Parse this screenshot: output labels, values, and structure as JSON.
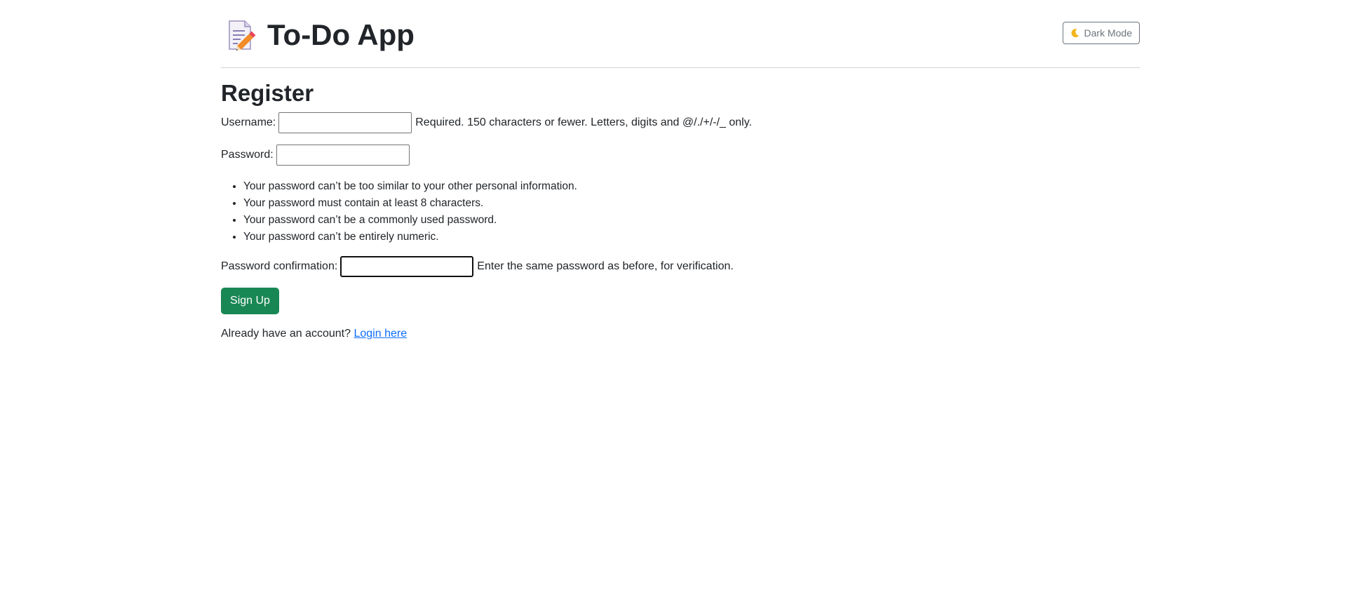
{
  "header": {
    "app_title": "To-Do App",
    "app_icon": "memo-pencil-icon",
    "dark_mode_label": "Dark Mode",
    "dark_mode_icon": "moon-icon"
  },
  "page": {
    "heading": "Register"
  },
  "form": {
    "username": {
      "label": "Username:",
      "value": "",
      "help": "Required. 150 characters or fewer. Letters, digits and @/./+/-/_ only."
    },
    "password": {
      "label": "Password:",
      "value": ""
    },
    "password_rules": [
      "Your password can’t be too similar to your other personal information.",
      "Your password must contain at least 8 characters.",
      "Your password can’t be a commonly used password.",
      "Your password can’t be entirely numeric."
    ],
    "password_confirmation": {
      "label": "Password confirmation:",
      "value": "",
      "help": "Enter the same password as before, for verification."
    },
    "submit_label": "Sign Up"
  },
  "footer": {
    "prompt": "Already have an account?",
    "login_link": "Login here"
  },
  "colors": {
    "primary_button": "#198754",
    "link": "#0d6efd",
    "text": "#212529",
    "secondary": "#6c757d"
  }
}
